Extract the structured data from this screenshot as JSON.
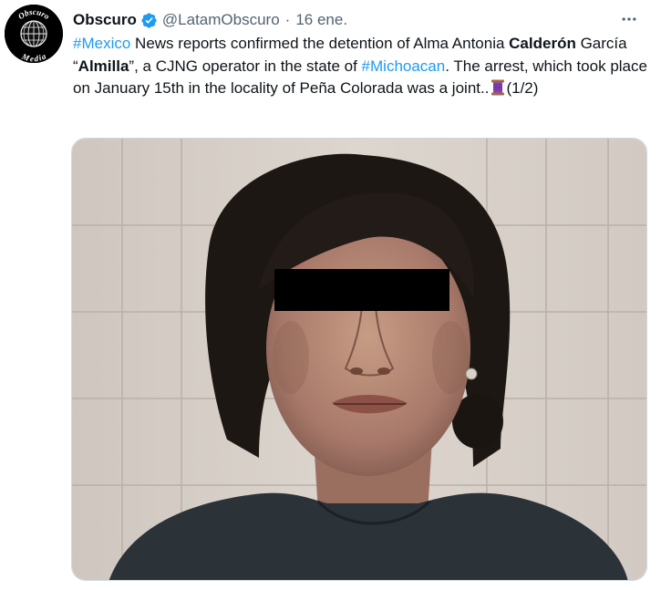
{
  "tweet": {
    "display_name": "Obscuro",
    "handle": "@LatamObscuro",
    "separator": "·",
    "date": "16 ene.",
    "avatar": {
      "top_text": "Obscuro",
      "bottom_text": "Media"
    },
    "text": {
      "hashtag_1": "#Mexico",
      "part_1": " News reports confirmed the detention of Alma Antonia ",
      "bold_1": "Calderón",
      "part_2": " García “",
      "bold_2": "Almilla",
      "part_3": "”, a CJNG operator in the state of ",
      "hashtag_2": "#Michoacan",
      "part_4": ". The arrest, which took place on January 15th in the locality of Peña Colorada was a joint..",
      "part_5": "(1/2)"
    },
    "icons": {
      "verified": "verified-badge-icon",
      "more": "more-options-icon",
      "thread": "thread-spool-emoji"
    },
    "colors": {
      "accent": "#1d9bf0",
      "secondary_text": "#536471",
      "primary_text": "#0f1419",
      "censor_bar": "#000000"
    }
  }
}
